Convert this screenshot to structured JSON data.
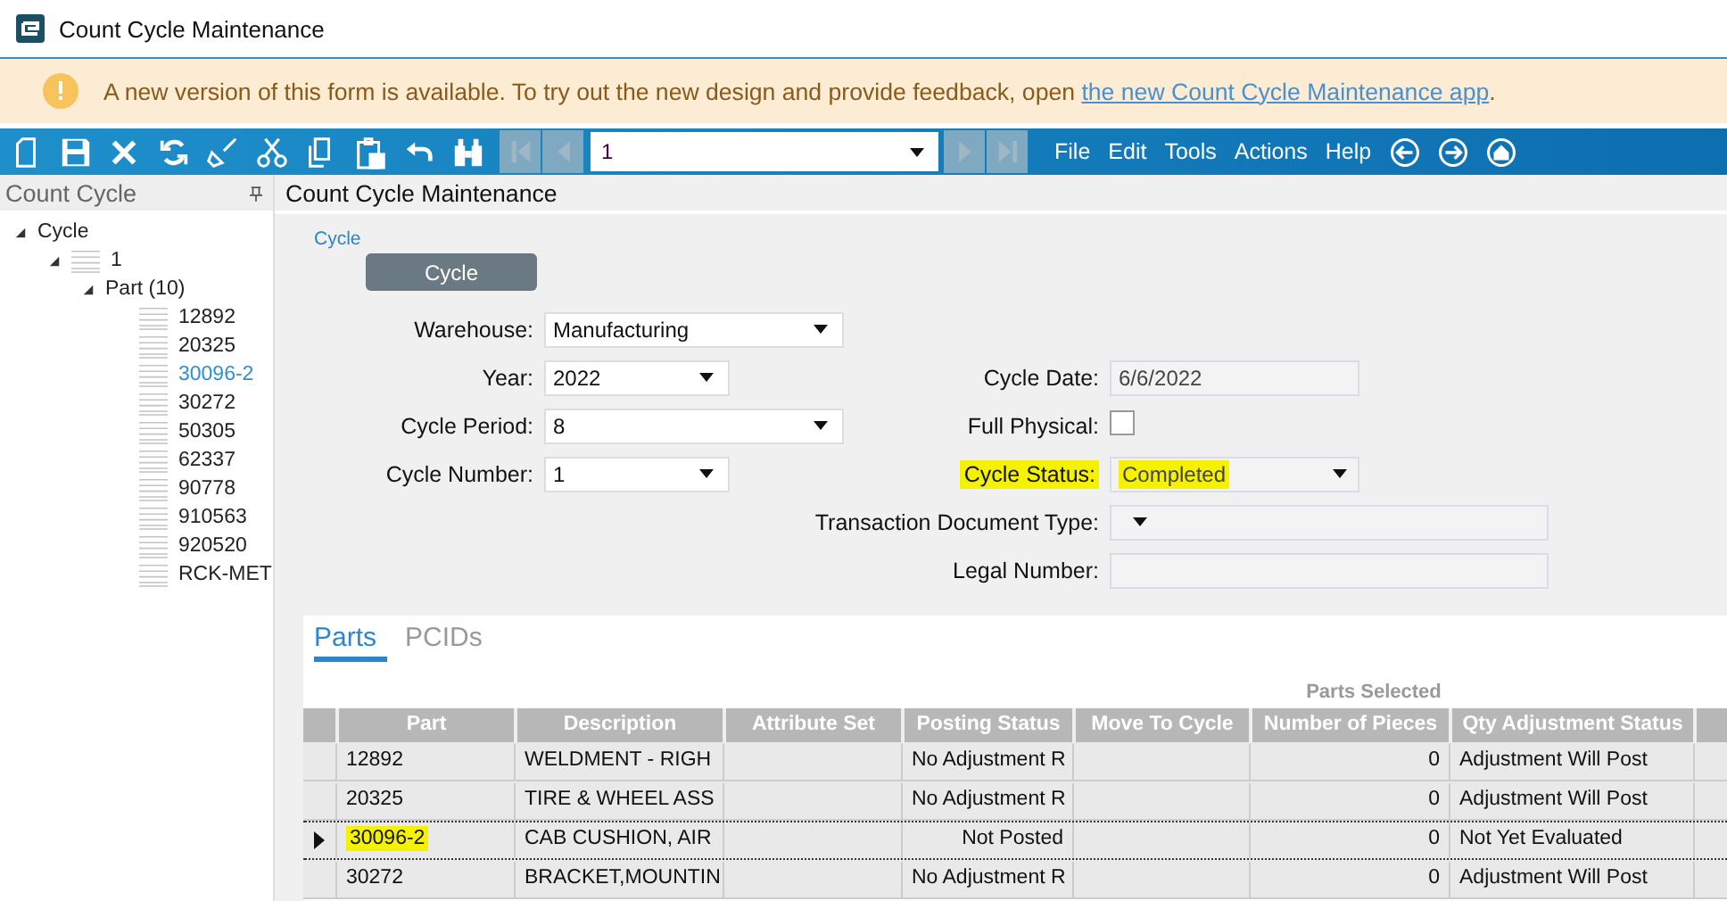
{
  "window": {
    "title": "Count Cycle Maintenance"
  },
  "banner": {
    "message": "A new version of this form is available. To try out the new design and provide feedback, open ",
    "link": "the new Count Cycle Maintenance app",
    "end": "."
  },
  "toolbar": {
    "record": "1",
    "menus": [
      "File",
      "Edit",
      "Tools",
      "Actions",
      "Help"
    ]
  },
  "sidebar": {
    "title": "Count Cycle",
    "tree": [
      {
        "label": "Cycle",
        "expanded": true,
        "selected": false,
        "children": [
          {
            "label": "1",
            "expanded": true,
            "selected": false,
            "children": [
              {
                "label": "Part (10)",
                "expanded": true,
                "selected": false,
                "children": [
                  {
                    "label": "12892",
                    "selected": false
                  },
                  {
                    "label": "20325",
                    "selected": false
                  },
                  {
                    "label": "30096-2",
                    "selected": true
                  },
                  {
                    "label": "30272",
                    "selected": false
                  },
                  {
                    "label": "50305",
                    "selected": false
                  },
                  {
                    "label": "62337",
                    "selected": false
                  },
                  {
                    "label": "90778",
                    "selected": false
                  },
                  {
                    "label": "910563",
                    "selected": false
                  },
                  {
                    "label": "920520",
                    "selected": false
                  },
                  {
                    "label": "RCK-MET",
                    "selected": false
                  }
                ]
              }
            ]
          }
        ]
      }
    ]
  },
  "form": {
    "title": "Count Cycle Maintenance",
    "section": "Cycle",
    "section_button": "Cycle",
    "left_fields": [
      {
        "label": "Warehouse:",
        "value": "Manufacturing",
        "kind": "wide"
      },
      {
        "label": "Year:",
        "value": "2022",
        "kind": "narrow"
      },
      {
        "label": "Cycle Period:",
        "value": "8",
        "kind": "wide"
      },
      {
        "label": "Cycle Number:",
        "value": "1",
        "kind": "narrow"
      }
    ],
    "right_fields": [
      {
        "label": "Cycle Date:",
        "value": "6/6/2022",
        "kind": "text",
        "highlighted": false
      },
      {
        "label": "Full Physical:",
        "kind": "checkbox",
        "checked": false,
        "highlighted": false
      },
      {
        "label": "Cycle Status:",
        "value": "Completed",
        "kind": "combo",
        "highlighted": true
      },
      {
        "label": "Transaction Document Type:",
        "kind": "wide-combo",
        "highlighted": false
      },
      {
        "label": "Legal Number:",
        "kind": "wide-text",
        "highlighted": false
      }
    ]
  },
  "tabs": [
    {
      "label": "Parts",
      "selected": true
    },
    {
      "label": "PCIDs",
      "selected": false
    }
  ],
  "table": {
    "group": "Parts Selected",
    "columns": [
      "Part",
      "Description",
      "Attribute Set",
      "Posting Status",
      "Move To Cycle",
      "Number of Pieces",
      "Qty Adjustment Status"
    ],
    "rows": [
      {
        "selected": false,
        "highlighted": false,
        "cells": [
          "12892",
          "WELDMENT - RIGH",
          "",
          "No Adjustment R",
          "",
          "0",
          "Adjustment Will Post"
        ]
      },
      {
        "selected": false,
        "highlighted": false,
        "cells": [
          "20325",
          "TIRE & WHEEL ASS",
          "",
          "No Adjustment R",
          "",
          "0",
          "Adjustment Will Post"
        ]
      },
      {
        "selected": true,
        "highlighted": true,
        "cells": [
          "30096-2",
          "CAB CUSHION, AIR",
          "",
          "Not Posted",
          "",
          "0",
          "Not Yet Evaluated"
        ]
      },
      {
        "selected": false,
        "highlighted": false,
        "cells": [
          "30272",
          "BRACKET,MOUNTIN",
          "",
          "No Adjustment R",
          "",
          "0",
          "Adjustment Will Post"
        ]
      }
    ]
  }
}
